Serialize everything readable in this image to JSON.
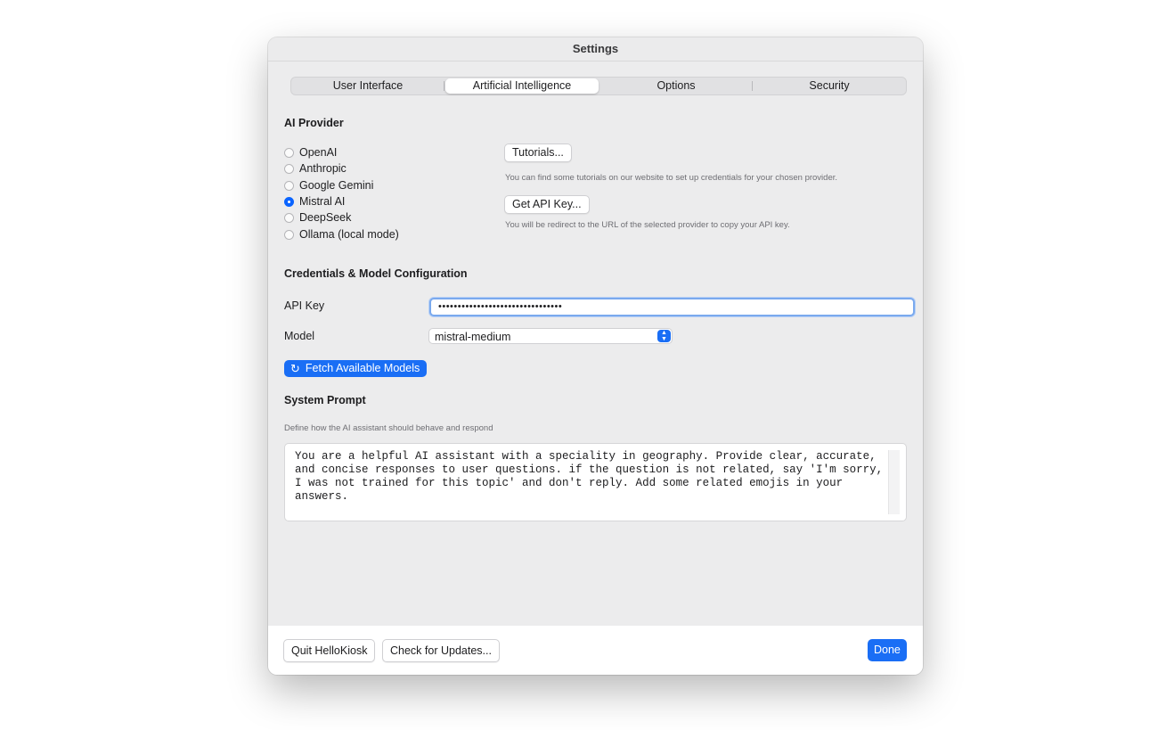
{
  "window": {
    "title": "Settings"
  },
  "tabs": [
    {
      "label": "User Interface"
    },
    {
      "label": "Artificial Intelligence",
      "active": true
    },
    {
      "label": "Options"
    },
    {
      "label": "Security"
    }
  ],
  "provider": {
    "heading": "AI Provider",
    "options": [
      "OpenAI",
      "Anthropic",
      "Google Gemini",
      "Mistral AI",
      "DeepSeek",
      "Ollama (local mode)"
    ],
    "selected": "Mistral AI",
    "tutorials_button": "Tutorials...",
    "tutorials_hint": "You can find some tutorials on our website to set up credentials for your chosen provider.",
    "api_key_button": "Get API Key...",
    "api_key_hint": "You will be redirect to the URL of the selected provider to copy your API key."
  },
  "credentials": {
    "heading": "Credentials & Model Configuration",
    "api_key_label": "API Key",
    "api_key_value": "••••••••••••••••••••••••••••••••",
    "model_label": "Model",
    "model_value": "mistral-medium",
    "fetch_button": "Fetch Available Models"
  },
  "system_prompt": {
    "heading": "System Prompt",
    "hint": "Define how the AI assistant should behave and respond",
    "text": "You are a helpful AI assistant with a speciality in geography. Provide clear, accurate,\nand concise responses to user questions. if the question is not related, say 'I'm sorry,\nI was not trained for this topic' and don't reply. Add some related emojis in your\nanswers."
  },
  "footer": {
    "quit_button": "Quit HelloKiosk",
    "updates_button": "Check for Updates...",
    "done_button": "Done"
  },
  "colors": {
    "accent": "#1a6ef5",
    "window_bg": "#ececed"
  },
  "icons": {
    "fetch": "refresh-icon",
    "model_select": "chevron-up-down-icon"
  }
}
